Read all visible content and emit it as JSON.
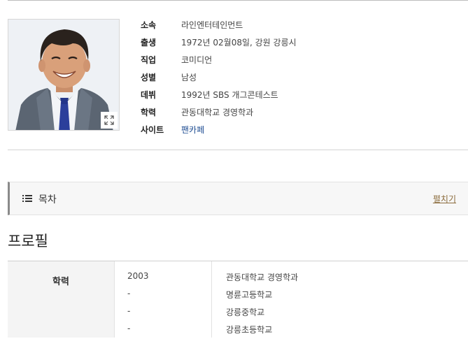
{
  "profile_info": {
    "rows": [
      {
        "label": "소속",
        "value": "라인엔터테인먼트",
        "is_link": false
      },
      {
        "label": "출생",
        "value": "1972년 02월08일, 강원 강릉시",
        "is_link": false
      },
      {
        "label": "직업",
        "value": "코미디언",
        "is_link": false
      },
      {
        "label": "성별",
        "value": "남성",
        "is_link": false
      },
      {
        "label": "데뷔",
        "value": "1992년 SBS 개그콘테스트",
        "is_link": false
      },
      {
        "label": "학력",
        "value": "관동대학교 경영학과",
        "is_link": false
      },
      {
        "label": "사이트",
        "value": "팬카페",
        "is_link": true
      }
    ]
  },
  "toc": {
    "title": "목차",
    "toggle_label": "펼치기"
  },
  "section": {
    "title": "프로필"
  },
  "education": {
    "label": "학력",
    "rows": [
      {
        "year": "2003",
        "school": "관동대학교 경영학과"
      },
      {
        "year": "-",
        "school": "명륜고등학교"
      },
      {
        "year": "-",
        "school": "강릉중학교"
      },
      {
        "year": "-",
        "school": "강릉초등학교"
      }
    ]
  },
  "colors": {
    "link": "#1f4d92",
    "toggle": "#8a6a3a"
  },
  "icons": {
    "photo_expand": "expand-icon",
    "toc": "list-icon"
  }
}
